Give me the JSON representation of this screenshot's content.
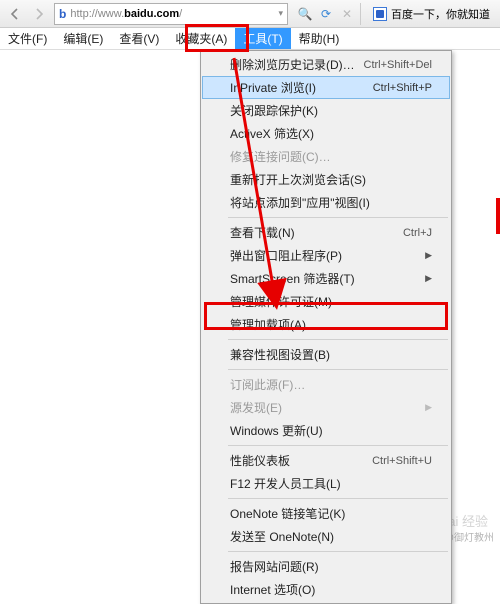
{
  "url_http": "http://www.",
  "url_domain": "baidu.com",
  "url_rest": "/",
  "tab_title": "百度一下，你就知道",
  "menubar": {
    "file": "文件(F)",
    "edit": "编辑(E)",
    "view": "查看(V)",
    "favorites": "收藏夹(A)",
    "tools": "工具(T)",
    "help": "帮助(H)"
  },
  "dropdown": {
    "delete_history": "删除浏览历史记录(D)…",
    "delete_history_sc": "Ctrl+Shift+Del",
    "inprivate": "InPrivate 浏览(I)",
    "inprivate_sc": "Ctrl+Shift+P",
    "tracking_protection": "关闭跟踪保护(K)",
    "activex": "ActiveX 筛选(X)",
    "fix_connection": "修复连接问题(C)…",
    "reopen_last": "重新打开上次浏览会话(S)",
    "add_to_apps": "将站点添加到\"应用\"视图(I)",
    "view_downloads": "查看下载(N)",
    "view_downloads_sc": "Ctrl+J",
    "popup_blocker": "弹出窗口阻止程序(P)",
    "smartscreen": "SmartScreen 筛选器(T)",
    "media_licenses": "管理媒体许可证(M)",
    "manage_addons": "管理加载项(A)",
    "compat_view": "兼容性视图设置(B)",
    "subscribe_feed": "订阅此源(F)…",
    "feed_discovery": "源发现(E)",
    "windows_update": "Windows 更新(U)",
    "perf_dashboard": "性能仪表板",
    "perf_dashboard_sc": "Ctrl+Shift+U",
    "f12_tools": "F12 开发人员工具(L)",
    "onenote_linked": "OneNote 链接笔记(K)",
    "send_to_onenote": "发送至 OneNote(N)",
    "report_problems": "报告网站问题(R)",
    "internet_options": "Internet 选项(O)"
  },
  "watermark1": "知乎 @御灯教州",
  "watermark2": "Bai 经验"
}
